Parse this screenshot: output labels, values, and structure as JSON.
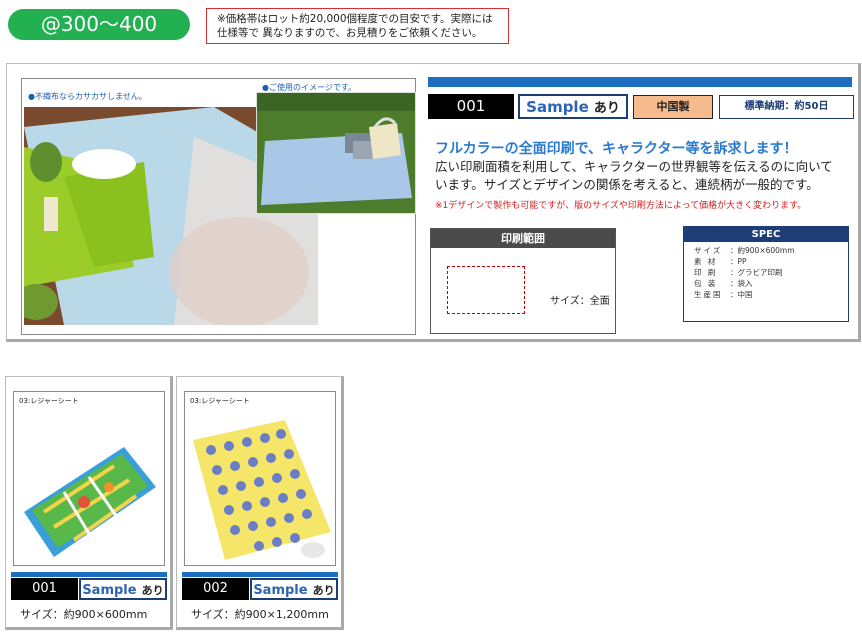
{
  "price": {
    "label": "@300～400"
  },
  "notice": {
    "text": "※価格帯はロット約20,000個程度での目安です。実際には\n仕様等で 異なりますので、お見積りをご依頼ください。"
  },
  "product": {
    "caption_left": "●不織布ならカサカサしません。",
    "caption_right": "●ご使用のイメージです。",
    "code": "001",
    "sample_word": "Sample",
    "sample_suffix": "あり",
    "origin": "中国製",
    "lead_time": "標準納期：約50日",
    "headline": "フルカラーの全面印刷で、キャラクター等を訴求します！",
    "description": "広い印刷面積を利用して、キャラクターの世界観等を伝えるのに向いています。サイズとデザインの関係を考えると、連続柄が一般的です。",
    "note": "※1デザインで製作も可能ですが、版のサイズや印刷方法によって価格が大きく変わります。",
    "print_range": {
      "title": "印刷範囲",
      "size_label": "サイズ：全面"
    },
    "spec": {
      "title": "SPEC",
      "rows": [
        {
          "key": "サイズ",
          "value": "約900×600mm"
        },
        {
          "key": "素 材",
          "value": "PP"
        },
        {
          "key": "印 刷",
          "value": "グラビア印刷"
        },
        {
          "key": "包 装",
          "value": "袋入"
        },
        {
          "key": "生産国",
          "value": "中国"
        }
      ]
    }
  },
  "variants": [
    {
      "label": "03:レジャーシート",
      "code": "001",
      "sample_word": "Sample",
      "sample_suffix": "あり",
      "size": "サイズ：約900×600mm"
    },
    {
      "label": "03:レジャーシート",
      "code": "002",
      "sample_word": "Sample",
      "sample_suffix": "あり",
      "size": "サイズ：約900×1,200mm"
    }
  ],
  "colors": {
    "accent_green": "#22b050",
    "accent_blue": "#1d6ec0",
    "navy": "#1d3d77",
    "origin_bg": "#f6bb8c",
    "note_red": "#d42020"
  }
}
